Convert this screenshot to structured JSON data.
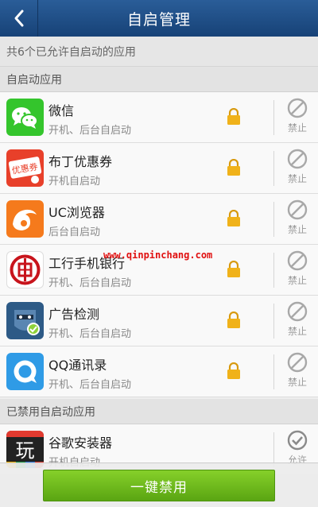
{
  "header": {
    "title": "自启管理"
  },
  "summary": "共6个已允许自启动的应用",
  "sections": {
    "enabled": "自启动应用",
    "disabled": "已禁用自启动应用"
  },
  "enabled_apps": [
    {
      "name": "微信",
      "desc": "开机、后台自启动",
      "action": "禁止",
      "icon": "wechat-icon"
    },
    {
      "name": "布丁优惠券",
      "desc": "开机自启动",
      "action": "禁止",
      "icon": "coupon-icon"
    },
    {
      "name": "UC浏览器",
      "desc": "后台自启动",
      "action": "禁止",
      "icon": "uc-browser-icon"
    },
    {
      "name": "工行手机银行",
      "desc": "开机、后台自启动",
      "action": "禁止",
      "icon": "icbc-icon"
    },
    {
      "name": "广告检测",
      "desc": "开机、后台自启动",
      "action": "禁止",
      "icon": "ad-detect-icon"
    },
    {
      "name": "QQ通讯录",
      "desc": "开机、后台自启动",
      "action": "禁止",
      "icon": "qq-contacts-icon"
    }
  ],
  "disabled_apps": [
    {
      "name": "谷歌安装器",
      "desc": "开机自启动",
      "action": "允许",
      "icon": "google-installer-icon"
    }
  ],
  "watermark": "www.qinpinchang.com",
  "bottom": {
    "button_label": "一键禁用"
  },
  "icon_text": {
    "coupon": "优惠券",
    "google": "玩"
  },
  "colors": {
    "header": "#1d4e89",
    "button": "#6cb71c",
    "lock": "#f0b21a"
  }
}
